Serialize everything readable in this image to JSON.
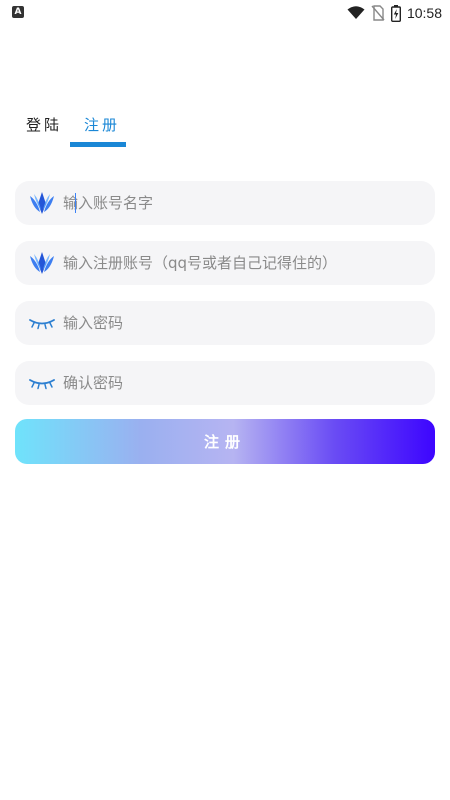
{
  "status_bar": {
    "app_icon": "A",
    "time": "10:58",
    "icons": [
      "wifi-icon",
      "no-sim-icon",
      "battery-charging-icon"
    ]
  },
  "tabs": [
    {
      "label": "登陆",
      "active": false
    },
    {
      "label": "注册",
      "active": true
    }
  ],
  "form": {
    "account_name_placeholder": "输入账号名字",
    "register_account_placeholder": "输入注册账号（qq号或者自己记得住的）",
    "password_placeholder": "输入密码",
    "confirm_password_placeholder": "确认密码",
    "submit_label": "注册"
  },
  "colors": {
    "accent": "#1a87d6",
    "field_bg": "#f5f5f7",
    "gradient_start": "#6fe3fb",
    "gradient_end": "#3d05ff"
  }
}
